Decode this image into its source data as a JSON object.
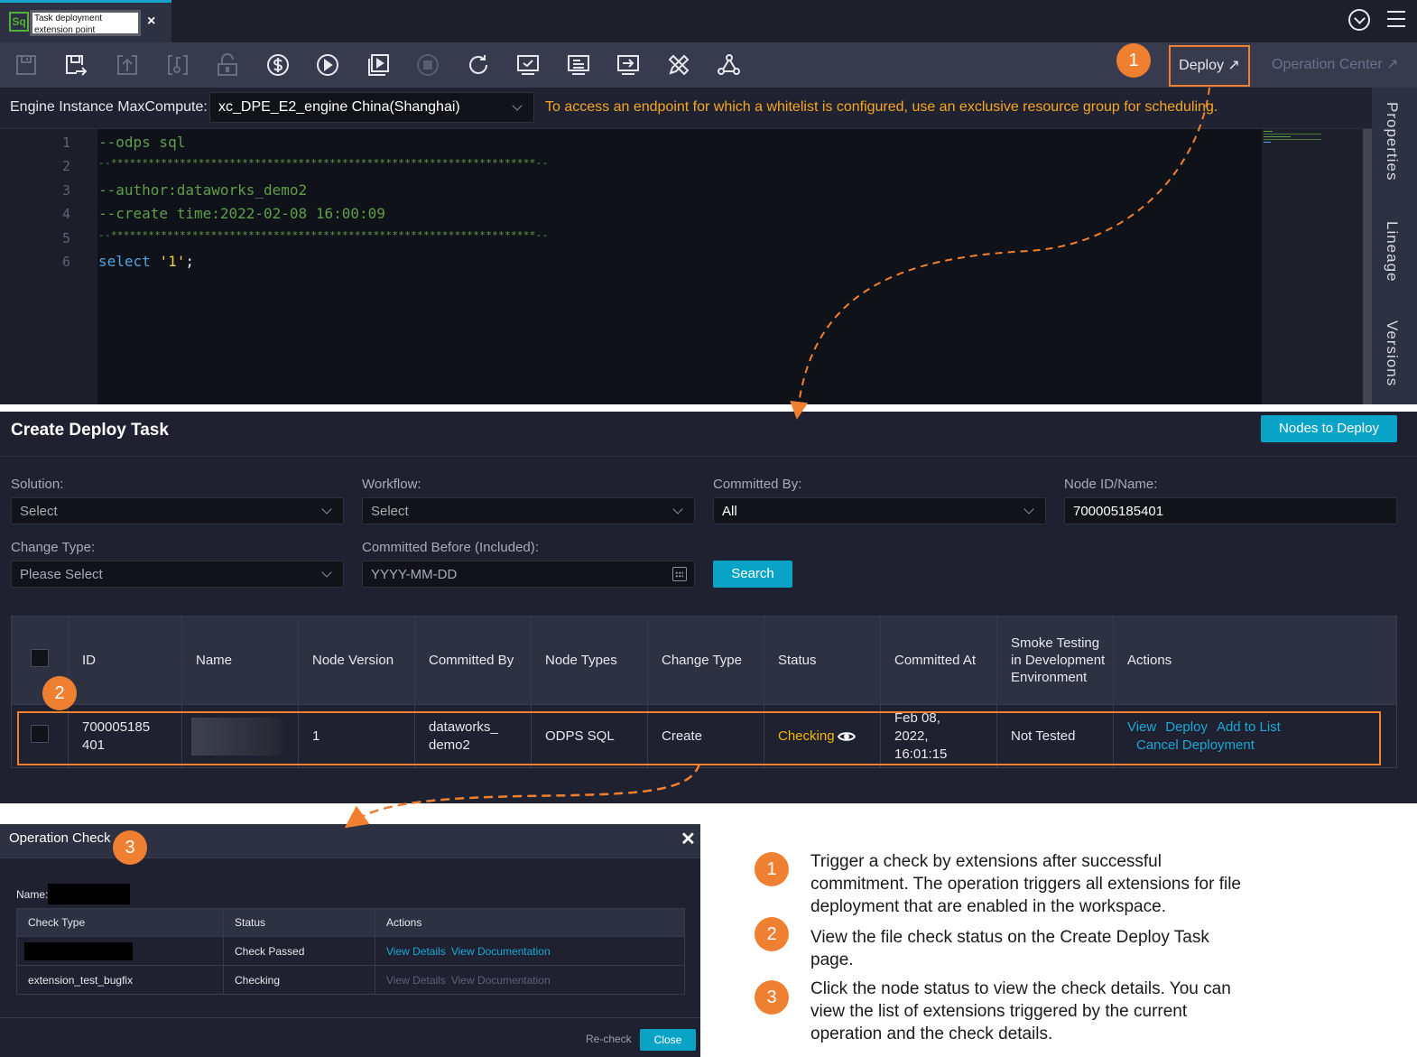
{
  "tab": {
    "icon_label": "Sq",
    "title": "Task deployment extension point",
    "close": "×"
  },
  "toolbar": {
    "icons": [
      "save-icon",
      "save-and-commit-icon",
      "commit-icon",
      "steal-lock-icon",
      "unlock-icon",
      "cost-estimate-icon",
      "run-icon",
      "run-with-params-icon",
      "stop-icon",
      "reload-icon",
      "precompile-icon",
      "format-icon",
      "deploy-to-ide-icon",
      "code-check-icon",
      "lineage-graph-icon"
    ],
    "deploy_label": "Deploy ↗",
    "operation_center_label": "Operation Center ↗"
  },
  "engine": {
    "label": "Engine Instance MaxCompute:",
    "selected": "xc_DPE_E2_engine China(Shanghai)",
    "warning": "To access an endpoint for which a whitelist is configured, use an exclusive resource group for scheduling."
  },
  "code": {
    "lines": [
      {
        "n": "1",
        "text": "--odps sql"
      },
      {
        "n": "2",
        "text": "--********************************************************************--"
      },
      {
        "n": "3",
        "text": "--author:dataworks_demo2"
      },
      {
        "n": "4",
        "text": "--create time:2022-02-08 16:00:09"
      },
      {
        "n": "5",
        "text": "--********************************************************************--"
      },
      {
        "n": "6",
        "kw": "select",
        "str": "'1'",
        "punc": ";"
      }
    ]
  },
  "side_tabs": [
    "Properties",
    "Lineage",
    "Versions"
  ],
  "deploy_task": {
    "title": "Create Deploy Task",
    "nodes_to_deploy": "Nodes to Deploy",
    "filters": {
      "solution": {
        "label": "Solution:",
        "value": "Select"
      },
      "workflow": {
        "label": "Workflow:",
        "value": "Select"
      },
      "committed_by": {
        "label": "Committed By:",
        "value": "All"
      },
      "node_id": {
        "label": "Node ID/Name:",
        "value": "700005185401"
      },
      "change_type": {
        "label": "Change Type:",
        "value": "Please Select"
      },
      "committed_before": {
        "label": "Committed Before (Included):",
        "placeholder": "YYYY-MM-DD"
      },
      "search": "Search"
    },
    "table": {
      "headers": [
        "ID",
        "Name",
        "Node Version",
        "Committed By",
        "Node Types",
        "Change Type",
        "Status",
        "Committed At",
        "Smoke Testing in Development Environment",
        "Actions"
      ],
      "rows": [
        {
          "id": "700005185 401",
          "name": "",
          "node_version": "1",
          "committed_by": "dataworks_ demo2",
          "node_type": "ODPS SQL",
          "change_type": "Create",
          "status": "Checking",
          "committed_at": "Feb 08, 2022, 16:01:15",
          "smoke_test": "Not Tested",
          "actions": [
            "View",
            "Deploy",
            "Add to List",
            "Cancel Deployment"
          ]
        }
      ]
    }
  },
  "operation_check": {
    "title": "Operation Check",
    "name_label": "Name:",
    "headers": [
      "Check Type",
      "Status",
      "Actions"
    ],
    "rows": [
      {
        "check_type": "",
        "status": "Check Passed",
        "actions": [
          "View Details",
          "View Documentation"
        ],
        "actions_enabled": true
      },
      {
        "check_type": "extension_test_bugfix",
        "status": "Checking",
        "actions": [
          "View Details",
          "View Documentation"
        ],
        "actions_enabled": false
      }
    ],
    "recheck": "Re-check",
    "close": "Close"
  },
  "legend": [
    {
      "num": "1",
      "text": "Trigger a check by extensions after successful commitment. The operation triggers all extensions for file deployment that are enabled in the workspace."
    },
    {
      "num": "2",
      "text": "View the file check status on the Create Deploy Task page."
    },
    {
      "num": "3",
      "text": "Click the node status to view the check details. You can view the list of extensions triggered by the current operation and the check details."
    }
  ],
  "callouts": [
    "1",
    "2",
    "3"
  ],
  "colors": {
    "accent": "#0aa3c8",
    "callout": "#ef8032",
    "warning": "#f5a623",
    "success": "#3eb14a",
    "checking": "#f5b800"
  }
}
